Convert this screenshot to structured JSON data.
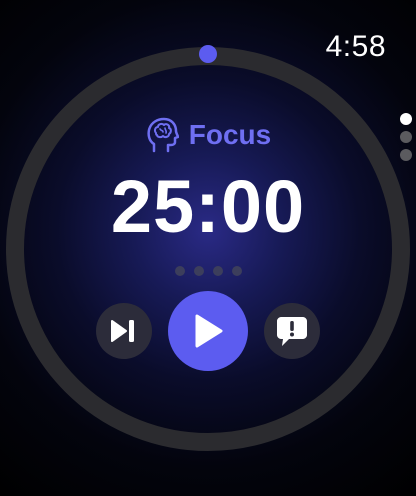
{
  "status_bar": {
    "time": "4:58"
  },
  "timer": {
    "mode_label": "Focus",
    "mode_icon": "brain-head-icon",
    "time_remaining": "25:00",
    "progress_fraction": 0,
    "sessions_total": 4,
    "sessions_completed": 0
  },
  "controls": {
    "skip_icon": "skip-forward-icon",
    "play_icon": "play-icon",
    "feedback_icon": "feedback-icon"
  },
  "pager": {
    "pages": 3,
    "active_index": 0
  },
  "colors": {
    "accent": "#5c5cf0",
    "mode_text": "#6f6ff2",
    "ring_track": "#2b2b2f",
    "button_bg": "#2c2c3a",
    "dot_inactive": "#3c3e5c"
  }
}
